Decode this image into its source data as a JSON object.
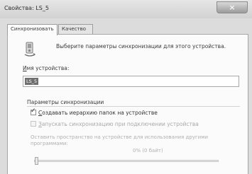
{
  "window": {
    "title": "Свойства: LS_5",
    "close_symbol": "×"
  },
  "tabs": [
    {
      "label": "Синхронизовать",
      "active": true
    },
    {
      "label": "Качество",
      "active": false
    }
  ],
  "intro": {
    "text": "Выберите параметры синхронизации для этого устройства.",
    "icon": "sync-device-icon"
  },
  "device_name": {
    "label_prefix": "",
    "label_accel": "И",
    "label_rest": "мя устройства:",
    "value": "LS_5"
  },
  "sync_params": {
    "group_title": "Параметры синхронизации",
    "options": [
      {
        "accel": "С",
        "label_rest": "оздавать иерархию папок на устройстве",
        "checked": true,
        "enabled": true
      },
      {
        "accel": "З",
        "label_rest": "апускать синхронизацию при подключении устройства",
        "checked": false,
        "enabled": false
      }
    ],
    "reserve_text": "Оставить пространство на устройстве для использования другими программами:",
    "reserve_value": "0% (0 байт)",
    "reserve_percent": 0
  }
}
